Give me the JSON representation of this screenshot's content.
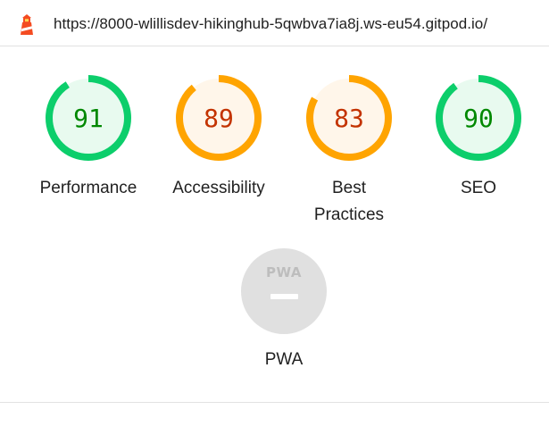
{
  "header": {
    "url": "https://8000-wlillisdev-hikinghub-5qwbva7ia8j.ws-eu54.gitpod.io/",
    "icon": "lighthouse-icon"
  },
  "categories": [
    {
      "id": "performance",
      "label": "Performance",
      "score": 91,
      "status": "pass"
    },
    {
      "id": "accessibility",
      "label": "Accessibility",
      "score": 89,
      "status": "average"
    },
    {
      "id": "best-practices",
      "label": "Best Practices",
      "score": 83,
      "status": "average"
    },
    {
      "id": "seo",
      "label": "SEO",
      "score": 90,
      "status": "pass"
    }
  ],
  "pwa": {
    "label": "PWA",
    "badge_text": "PWA",
    "icon": "pwa-icon"
  },
  "colors": {
    "pass": "#0cce6b",
    "pass_fill": "#e8faef",
    "pass_text": "#008800",
    "average": "#ffa400",
    "average_fill": "#fff6ea",
    "average_text": "#c33300",
    "brand": "#f44b21",
    "neutral": "#e0e0e0"
  }
}
